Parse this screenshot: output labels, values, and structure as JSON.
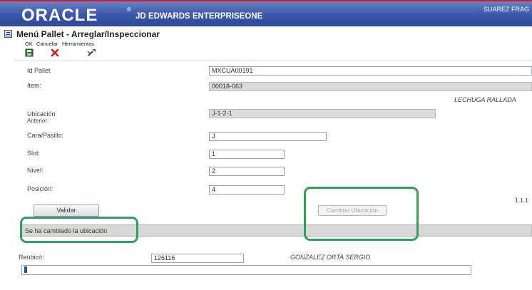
{
  "header": {
    "logo": "ORACLE",
    "logo_reg": "®",
    "product": "JD EDWARDS ENTERPRISEONE",
    "user": "SUAREZ FRAG"
  },
  "form": {
    "title": "Menú Pallet - Arreglar/Inspeccionar"
  },
  "toolbar": {
    "ok_label": "OK",
    "cancel_label": "Cancelar",
    "tools_label": "Herramientas"
  },
  "fields": {
    "id_pallet": {
      "label": "Id Pallet",
      "value": "MXCUA00191"
    },
    "item": {
      "label": "Item:",
      "value": "00018-063",
      "description": "LECHUGA RALLADA"
    },
    "ubicacion_anterior": {
      "label_line1": "Ubicación",
      "label_line2": "Anterior:",
      "value": "J-1-2-1"
    },
    "cara_pasillo": {
      "label": "Cara/Pasillo:",
      "value": "J"
    },
    "slot": {
      "label": "Slot:",
      "value": "1"
    },
    "nivel": {
      "label": "Nivel:",
      "value": "2"
    },
    "posicion": {
      "label": "Posición:",
      "value": "4"
    }
  },
  "version": "1.1.1",
  "buttons": {
    "validar": "Validar",
    "cambiar_ubicacion": "Cambiar Ubicación"
  },
  "status_message": "Se ha cambiado la ubicación",
  "reubico": {
    "label": "Reubicó:",
    "value": "126116",
    "name": "GONZALEZ ORTA SERGIO"
  },
  "colors": {
    "header_blue": "#3b57a8",
    "header_red": "#c8202a",
    "highlight_green": "#2fa05a"
  }
}
